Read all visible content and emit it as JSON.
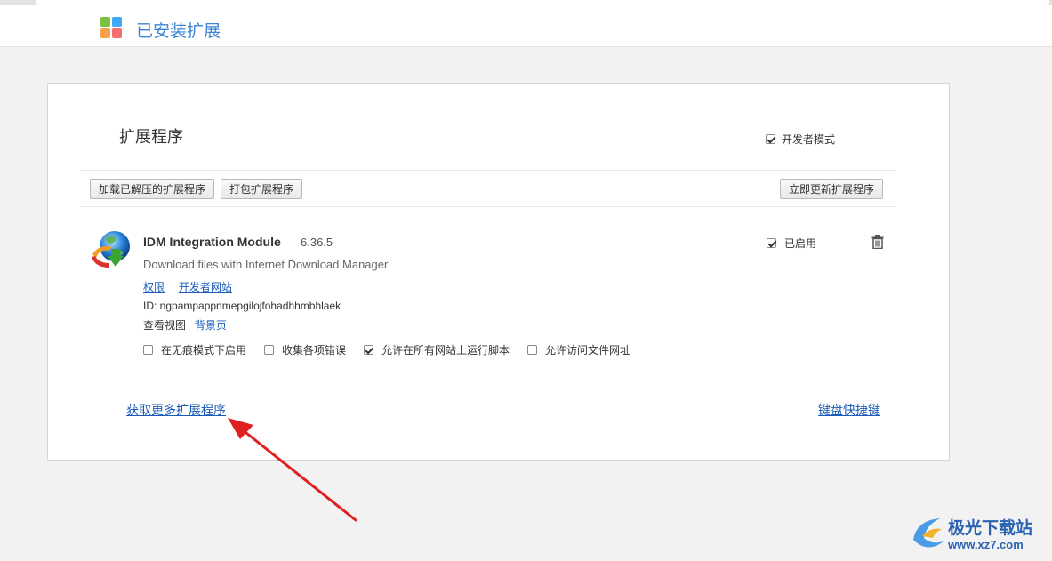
{
  "header": {
    "title": "已安装扩展",
    "logo_colors": [
      "#7ac143",
      "#3fa9f5",
      "#f7a24a",
      "#f06f6f"
    ]
  },
  "panel": {
    "section_title": "扩展程序",
    "developer_mode": {
      "label": "开发者模式",
      "checked": true
    },
    "buttons": {
      "load_unpacked": "加载已解压的扩展程序",
      "pack": "打包扩展程序",
      "update_now": "立即更新扩展程序"
    }
  },
  "extension": {
    "name": "IDM Integration Module",
    "version": "6.36.5",
    "description": "Download files with Internet Download Manager",
    "links": {
      "permissions": "权限",
      "developer_site": "开发者网站"
    },
    "id": "ID: ngpampappnmepgilojfohadhhmbhlaek",
    "inspect_views_label": "查看视图",
    "background_page": "背景页",
    "enabled": {
      "label": "已启用",
      "checked": true
    },
    "options": [
      {
        "label": "在无痕模式下启用",
        "checked": false
      },
      {
        "label": "收集各项错误",
        "checked": false
      },
      {
        "label": "允许在所有网站上运行脚本",
        "checked": true
      },
      {
        "label": "允许访问文件网址",
        "checked": false
      }
    ],
    "icons": {
      "delete": "trash-icon",
      "extension": "globe-download-icon"
    }
  },
  "footer": {
    "get_more": "获取更多扩展程序",
    "keyboard_shortcuts": "键盘快捷键"
  },
  "annotation": {
    "arrow_color": "#e02020"
  },
  "watermark": {
    "title": "极光下载站",
    "url": "www.xz7.com"
  }
}
